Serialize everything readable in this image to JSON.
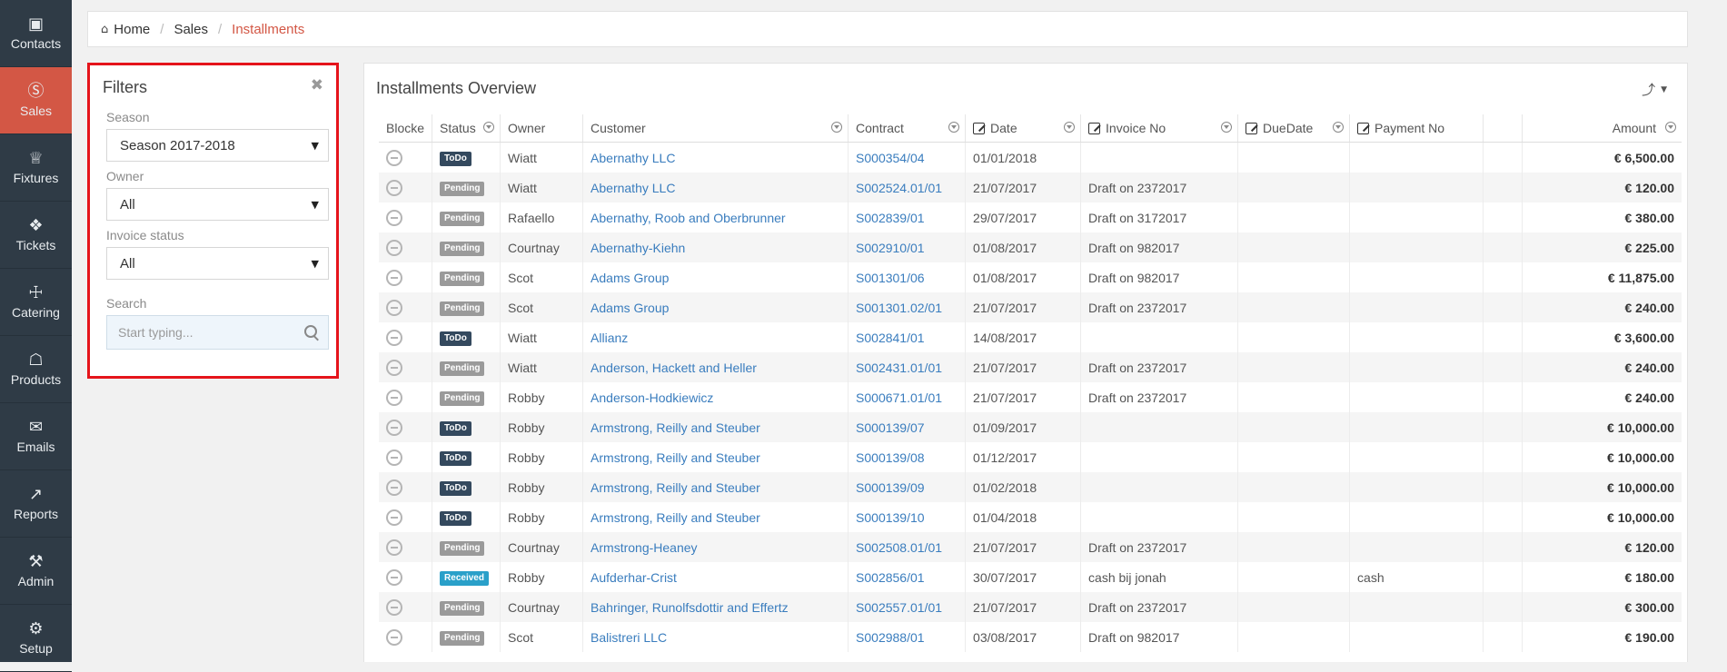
{
  "sidebar": {
    "items": [
      {
        "label": "Contacts",
        "icon": "contacts-icon",
        "glyph": "▣",
        "active": false
      },
      {
        "label": "Sales",
        "icon": "dollar-icon",
        "glyph": "Ⓢ",
        "active": true
      },
      {
        "label": "Fixtures",
        "icon": "trophy-icon",
        "glyph": "♕",
        "active": false
      },
      {
        "label": "Tickets",
        "icon": "ticket-icon",
        "glyph": "❖",
        "active": false
      },
      {
        "label": "Catering",
        "icon": "cutlery-icon",
        "glyph": "☩",
        "active": false
      },
      {
        "label": "Products",
        "icon": "cart-icon",
        "glyph": "☖",
        "active": false
      },
      {
        "label": "Emails",
        "icon": "envelope-icon",
        "glyph": "✉",
        "active": false
      },
      {
        "label": "Reports",
        "icon": "chart-icon",
        "glyph": "↗",
        "active": false
      },
      {
        "label": "Admin",
        "icon": "tools-icon",
        "glyph": "⚒",
        "active": false
      },
      {
        "label": "Setup",
        "icon": "gear-icon",
        "glyph": "⚙",
        "active": false
      }
    ]
  },
  "breadcrumb": {
    "home": "Home",
    "section": "Sales",
    "current": "Installments"
  },
  "filters": {
    "title": "Filters",
    "season_label": "Season",
    "season_value": "Season 2017-2018",
    "owner_label": "Owner",
    "owner_value": "All",
    "invoice_status_label": "Invoice status",
    "invoice_status_value": "All",
    "search_label": "Search",
    "search_placeholder": "Start typing..."
  },
  "overview": {
    "title": "Installments Overview",
    "columns": {
      "blocked": "Blocke",
      "status": "Status",
      "owner": "Owner",
      "customer": "Customer",
      "contract": "Contract",
      "date": "Date",
      "invoice_no": "Invoice No",
      "due_date": "DueDate",
      "payment_no": "Payment No",
      "amount": "Amount"
    },
    "rows": [
      {
        "status": "ToDo",
        "owner": "Wiatt",
        "customer": "Abernathy LLC",
        "contract": "S000354/04",
        "date": "01/01/2018",
        "invoice": "",
        "due": "",
        "payment": "",
        "amount": "€ 6,500.00"
      },
      {
        "status": "Pending",
        "owner": "Wiatt",
        "customer": "Abernathy LLC",
        "contract": "S002524.01/01",
        "date": "21/07/2017",
        "invoice": "Draft on 2372017",
        "due": "",
        "payment": "",
        "amount": "€ 120.00"
      },
      {
        "status": "Pending",
        "owner": "Rafaello",
        "customer": "Abernathy, Roob and Oberbrunner",
        "contract": "S002839/01",
        "date": "29/07/2017",
        "invoice": "Draft on 3172017",
        "due": "",
        "payment": "",
        "amount": "€ 380.00"
      },
      {
        "status": "Pending",
        "owner": "Courtnay",
        "customer": "Abernathy-Kiehn",
        "contract": "S002910/01",
        "date": "01/08/2017",
        "invoice": "Draft on 982017",
        "due": "",
        "payment": "",
        "amount": "€ 225.00"
      },
      {
        "status": "Pending",
        "owner": "Scot",
        "customer": "Adams Group",
        "contract": "S001301/06",
        "date": "01/08/2017",
        "invoice": "Draft on 982017",
        "due": "",
        "payment": "",
        "amount": "€ 11,875.00"
      },
      {
        "status": "Pending",
        "owner": "Scot",
        "customer": "Adams Group",
        "contract": "S001301.02/01",
        "date": "21/07/2017",
        "invoice": "Draft on 2372017",
        "due": "",
        "payment": "",
        "amount": "€ 240.00"
      },
      {
        "status": "ToDo",
        "owner": "Wiatt",
        "customer": "Allianz",
        "contract": "S002841/01",
        "date": "14/08/2017",
        "invoice": "",
        "due": "",
        "payment": "",
        "amount": "€ 3,600.00"
      },
      {
        "status": "Pending",
        "owner": "Wiatt",
        "customer": "Anderson, Hackett and Heller",
        "contract": "S002431.01/01",
        "date": "21/07/2017",
        "invoice": "Draft on 2372017",
        "due": "",
        "payment": "",
        "amount": "€ 240.00"
      },
      {
        "status": "Pending",
        "owner": "Robby",
        "customer": "Anderson-Hodkiewicz",
        "contract": "S000671.01/01",
        "date": "21/07/2017",
        "invoice": "Draft on 2372017",
        "due": "",
        "payment": "",
        "amount": "€ 240.00"
      },
      {
        "status": "ToDo",
        "owner": "Robby",
        "customer": "Armstrong, Reilly and Steuber",
        "contract": "S000139/07",
        "date": "01/09/2017",
        "invoice": "",
        "due": "",
        "payment": "",
        "amount": "€ 10,000.00"
      },
      {
        "status": "ToDo",
        "owner": "Robby",
        "customer": "Armstrong, Reilly and Steuber",
        "contract": "S000139/08",
        "date": "01/12/2017",
        "invoice": "",
        "due": "",
        "payment": "",
        "amount": "€ 10,000.00"
      },
      {
        "status": "ToDo",
        "owner": "Robby",
        "customer": "Armstrong, Reilly and Steuber",
        "contract": "S000139/09",
        "date": "01/02/2018",
        "invoice": "",
        "due": "",
        "payment": "",
        "amount": "€ 10,000.00"
      },
      {
        "status": "ToDo",
        "owner": "Robby",
        "customer": "Armstrong, Reilly and Steuber",
        "contract": "S000139/10",
        "date": "01/04/2018",
        "invoice": "",
        "due": "",
        "payment": "",
        "amount": "€ 10,000.00"
      },
      {
        "status": "Pending",
        "owner": "Courtnay",
        "customer": "Armstrong-Heaney",
        "contract": "S002508.01/01",
        "date": "21/07/2017",
        "invoice": "Draft on 2372017",
        "due": "",
        "payment": "",
        "amount": "€ 120.00"
      },
      {
        "status": "Received",
        "owner": "Robby",
        "customer": "Aufderhar-Crist",
        "contract": "S002856/01",
        "date": "30/07/2017",
        "invoice": "cash bij jonah",
        "due": "",
        "payment": "cash",
        "amount": "€ 180.00"
      },
      {
        "status": "Pending",
        "owner": "Courtnay",
        "customer": "Bahringer, Runolfsdottir and Effertz",
        "contract": "S002557.01/01",
        "date": "21/07/2017",
        "invoice": "Draft on 2372017",
        "due": "",
        "payment": "",
        "amount": "€ 300.00"
      },
      {
        "status": "Pending",
        "owner": "Scot",
        "customer": "Balistreri LLC",
        "contract": "S002988/01",
        "date": "03/08/2017",
        "invoice": "Draft on 982017",
        "due": "",
        "payment": "",
        "amount": "€ 190.00"
      }
    ]
  },
  "colors": {
    "accent": "#d35745",
    "sidebar": "#2f3b46",
    "link": "#3a7dbe",
    "todo": "#34495e",
    "pending": "#9a9a9a",
    "received": "#2aa0c9",
    "highlight": "#e5141b"
  }
}
